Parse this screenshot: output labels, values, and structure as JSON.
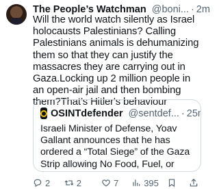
{
  "tweet": {
    "author_name": "The People’s Watchman",
    "handle": "@boni...",
    "separator": "·",
    "time": "2m",
    "text": "Will the world watch silently as Israel holocausts Palestinians? Calling Palestinians animals is dehumanizing them so that they can justify the massacres they are carrying out in Gaza.Locking up 2 million people in an open-air jail and then bombing them?That’s Hitler's behaviour"
  },
  "quoted_tweet": {
    "author_name": "OSINTdefender",
    "handle": "@sentdef...",
    "separator": "·",
    "time": "25m",
    "text": "Israeli Minister of Defense, Yoav Gallant announces that he has ordered a “Total Siege” of the Gaza Strip allowing No Food, Fuel, or Electricity alongside anything else to entered the Strip; Galla..."
  },
  "actions": {
    "replies": "2",
    "retweets": "2",
    "likes": "7",
    "views": "395"
  },
  "colors": {
    "verified": "#1d9bf0",
    "secondary_text": "#536471",
    "border": "#cfd9de"
  },
  "icons": [
    "verified-badge-icon",
    "reply-icon",
    "retweet-icon",
    "like-icon",
    "views-icon",
    "bookmark-icon",
    "share-icon"
  ]
}
